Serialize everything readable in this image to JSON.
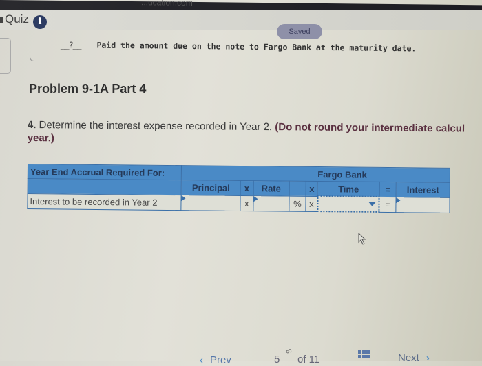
{
  "topbar": {
    "partial_url_text": "...ucation.com"
  },
  "header": {
    "quiz_label": "Quiz",
    "info_icon": "info-icon",
    "saved_status": "Saved"
  },
  "journal": {
    "blank_marker": "__?__",
    "entry_text": "Paid the amount due on the note to Fargo Bank at the maturity date."
  },
  "problem": {
    "title": "Problem 9-1A Part 4",
    "question_number": "4.",
    "question_text": " Determine the interest expense recorded in Year 2. ",
    "question_note": "(Do not round your intermediate calculations. Round final answers to nearest whole dollar for the year.)",
    "question_note_visible_line1": "(Do not round your intermediate calcul",
    "question_note_visible_line2": "year.)"
  },
  "table": {
    "header_label": "Year End Accrual Required For:",
    "group_label": "Fargo Bank",
    "columns": {
      "principal": "Principal",
      "op1": "x",
      "rate": "Rate",
      "op2": "x",
      "time": "Time",
      "op3": "=",
      "interest": "Interest"
    },
    "rows": [
      {
        "label": "Interest to be recorded in Year 2",
        "principal_value": "",
        "op1": "x",
        "rate_value": "",
        "percent": "%",
        "op2": "x",
        "time_value": "",
        "op3": "=",
        "interest_value": ""
      }
    ]
  },
  "footer": {
    "prev_label": "Prev",
    "page_current": "5",
    "page_total_label": "of 11",
    "next_label": "Next"
  }
}
